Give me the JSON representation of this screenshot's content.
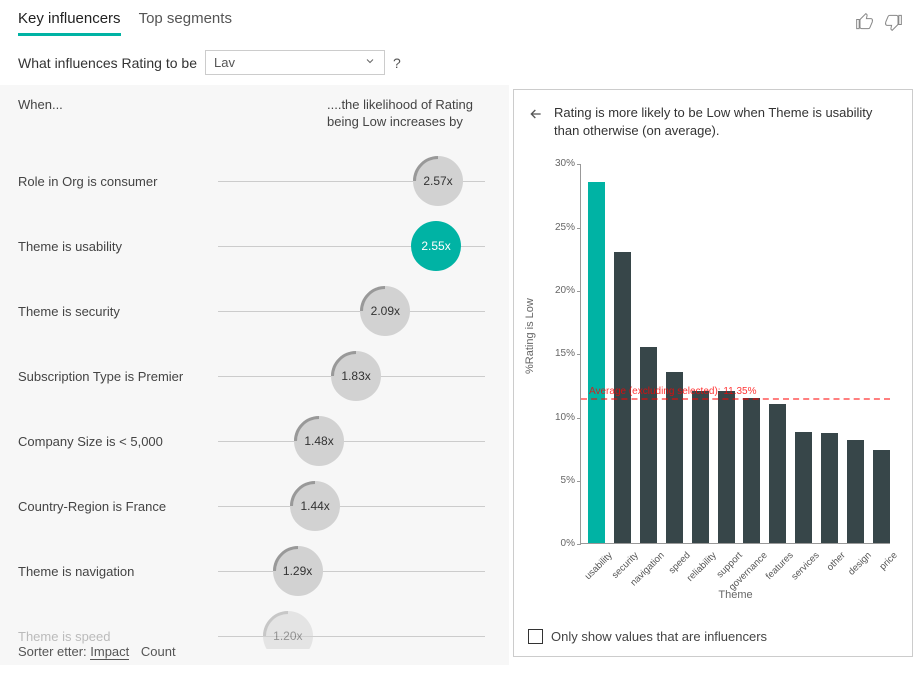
{
  "tabs": {
    "key_influencers": "Key influencers",
    "top_segments": "Top segments"
  },
  "question_prefix": "What influences Rating to be",
  "dropdown_value": "Lav",
  "help_symbol": "?",
  "headers": {
    "when": "When...",
    "likelihood": "....the likelihood of Rating being Low increases by"
  },
  "influencers": [
    {
      "label": "Role in Org is consumer",
      "value": "2.57x",
      "pos": 1.0
    },
    {
      "label": "Theme is usability",
      "value": "2.55x",
      "pos": 0.99,
      "selected": true
    },
    {
      "label": "Theme is security",
      "value": "2.09x",
      "pos": 0.73
    },
    {
      "label": "Subscription Type is Premier",
      "value": "1.83x",
      "pos": 0.58
    },
    {
      "label": "Company Size is < 5,000",
      "value": "1.48x",
      "pos": 0.39
    },
    {
      "label": "Country-Region is France",
      "value": "1.44x",
      "pos": 0.37
    },
    {
      "label": "Theme is navigation",
      "value": "1.29x",
      "pos": 0.28
    },
    {
      "label": "Theme is speed",
      "value": "1.20x",
      "pos": 0.23,
      "faded": true
    }
  ],
  "sort": {
    "label": "Sorter etter:",
    "impact": "Impact",
    "count": "Count"
  },
  "right_panel": {
    "summary": "Rating is more likely to be Low when Theme is usability than otherwise (on average).",
    "avg_label": "Average (excluding selected): 11.35%",
    "checkbox_label": "Only show values that are influencers"
  },
  "chart_data": {
    "type": "bar",
    "title": "",
    "xlabel": "Theme",
    "ylabel": "%Rating is Low",
    "ylim": [
      0,
      30
    ],
    "y_ticks": [
      "0%",
      "5%",
      "10%",
      "15%",
      "20%",
      "25%",
      "30%"
    ],
    "reference_value": 11.35,
    "highlight_category": "usability",
    "categories": [
      "usability",
      "security",
      "navigation",
      "speed",
      "reliability",
      "support",
      "governance",
      "features",
      "services",
      "other",
      "design",
      "price"
    ],
    "values": [
      28.5,
      23.0,
      15.5,
      13.5,
      12.0,
      12.0,
      11.5,
      11.0,
      8.8,
      8.7,
      8.2,
      7.4
    ]
  }
}
